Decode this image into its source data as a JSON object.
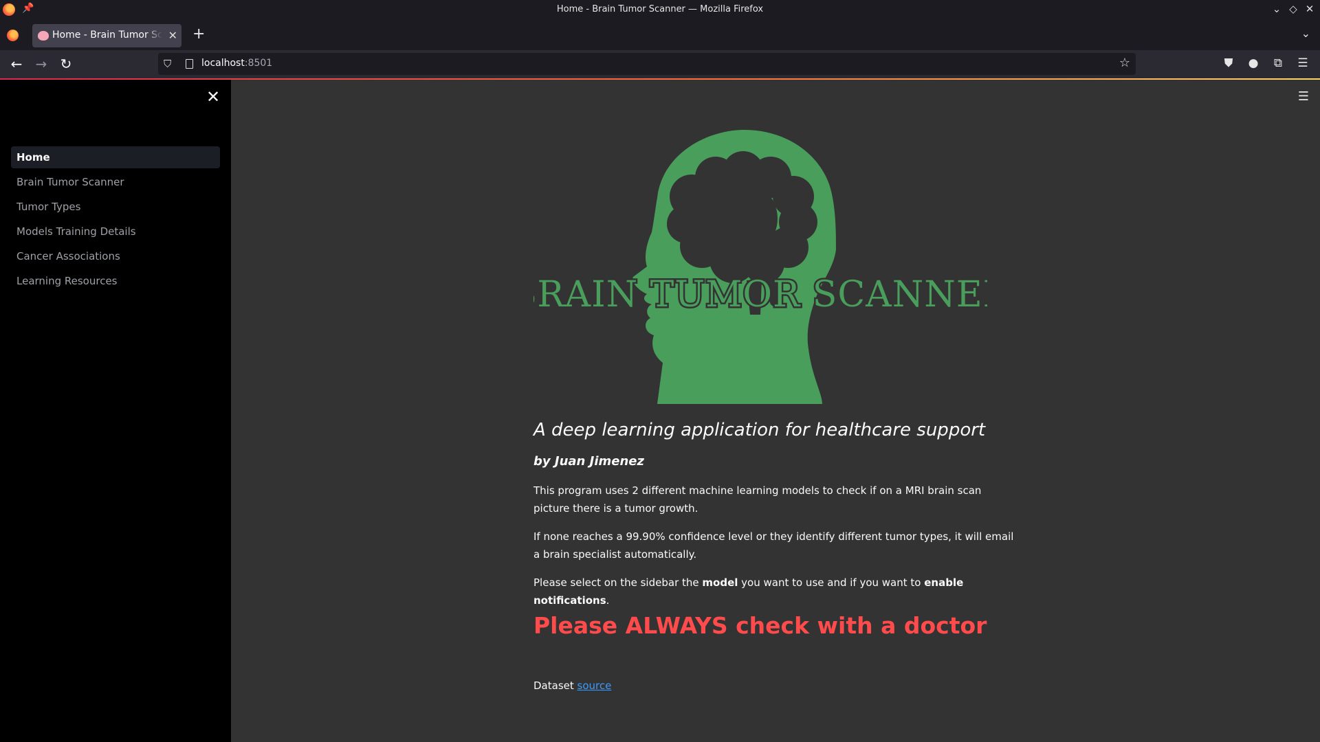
{
  "window": {
    "title": "Home - Brain Tumor Scanner — Mozilla Firefox",
    "controls": [
      "chevron-down",
      "restore",
      "close"
    ]
  },
  "tabs": [
    {
      "label": "Home - Brain Tumor Scanner",
      "icon": "brain-favicon",
      "active": true
    }
  ],
  "toolbar": {
    "url_host": "localhost",
    "url_port": ":8501",
    "icons": [
      "back-icon",
      "forward-icon",
      "reload-icon",
      "shield-icon",
      "star-icon",
      "pocket-icon",
      "account-icon",
      "extensions-icon",
      "menu-icon"
    ]
  },
  "sidebar": {
    "items": [
      {
        "label": "Home",
        "active": true
      },
      {
        "label": "Brain Tumor Scanner",
        "active": false
      },
      {
        "label": "Tumor Types",
        "active": false
      },
      {
        "label": "Models Training Details",
        "active": false
      },
      {
        "label": "Cancer Associations",
        "active": false
      },
      {
        "label": "Learning Resources",
        "active": false
      }
    ]
  },
  "main": {
    "logo_text": "BRAIN TUMOR SCANNER",
    "headline": "A deep learning application for healthcare support",
    "byline": "by Juan Jimenez",
    "para1": "This program uses 2 different machine learning models to check if on a MRI brain scan picture there is a tumor growth.",
    "para2": "If none reaches a 99.90% confidence level or they identify different tumor types, it will email a brain specialist automatically.",
    "para3_a": "Please select on the sidebar the ",
    "para3_b": "model",
    "para3_c": " you want to use and if you want to ",
    "para3_d": "enable notifications",
    "para3_e": ".",
    "warning": "Please ALWAYS check with a doctor",
    "dataset_label": "Dataset ",
    "dataset_link": "source"
  },
  "colors": {
    "logo_green": "#4a9e5c",
    "warning_red": "#ff4b4b",
    "link_blue": "#3b9cff",
    "sidebar_bg": "#000000",
    "main_bg": "#333333"
  }
}
